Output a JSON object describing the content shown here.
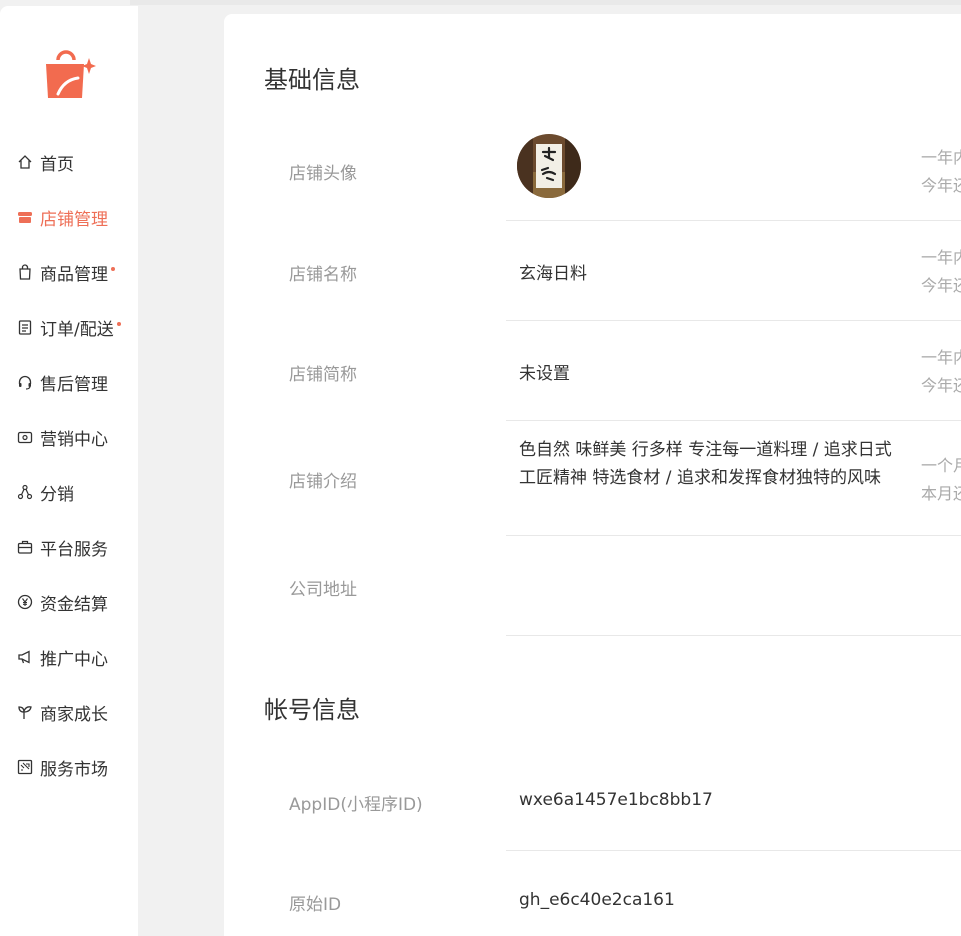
{
  "nav": {
    "items": [
      {
        "label": "首页",
        "icon": "home-icon"
      },
      {
        "label": "店铺管理",
        "icon": "store-icon",
        "active": true
      },
      {
        "label": "商品管理",
        "icon": "bag-icon",
        "dot": true
      },
      {
        "label": "订单/配送",
        "icon": "clipboard-icon",
        "dot": true
      },
      {
        "label": "售后管理",
        "icon": "headset-icon"
      },
      {
        "label": "营销中心",
        "icon": "coupon-icon"
      },
      {
        "label": "分销",
        "icon": "share-icon"
      },
      {
        "label": "平台服务",
        "icon": "briefcase-icon"
      },
      {
        "label": "资金结算",
        "icon": "yen-icon"
      },
      {
        "label": "推广中心",
        "icon": "megaphone-icon"
      },
      {
        "label": "商家成长",
        "icon": "sprout-icon"
      },
      {
        "label": "服务市场",
        "icon": "market-icon"
      }
    ]
  },
  "basic": {
    "title": "基础信息",
    "rows": [
      {
        "label": "店铺头像",
        "value": "",
        "hint1": "一年内",
        "hint2": "今年还"
      },
      {
        "label": "店铺名称",
        "value": "玄海日料",
        "hint1": "一年内",
        "hint2": "今年还"
      },
      {
        "label": "店铺简称",
        "value": "未设置",
        "hint1": "一年内",
        "hint2": "今年还"
      },
      {
        "label": "店铺介绍",
        "value": "色自然 味鲜美 行多样 专注每一道料理 / 追求日式工匠精神 特选食材 / 追求和发挥食材独特的风味",
        "hint1": "一个月",
        "hint2": "本月还"
      },
      {
        "label": "公司地址",
        "value": ""
      }
    ]
  },
  "account": {
    "title": "帐号信息",
    "rows": [
      {
        "label": "AppID(小程序ID)",
        "value": "wxe6a1457e1bc8bb17"
      },
      {
        "label": "原始ID",
        "value": "gh_e6c40e2ca161"
      }
    ]
  },
  "colors": {
    "accent": "#ee6f57",
    "logo": "#f26b4f"
  }
}
